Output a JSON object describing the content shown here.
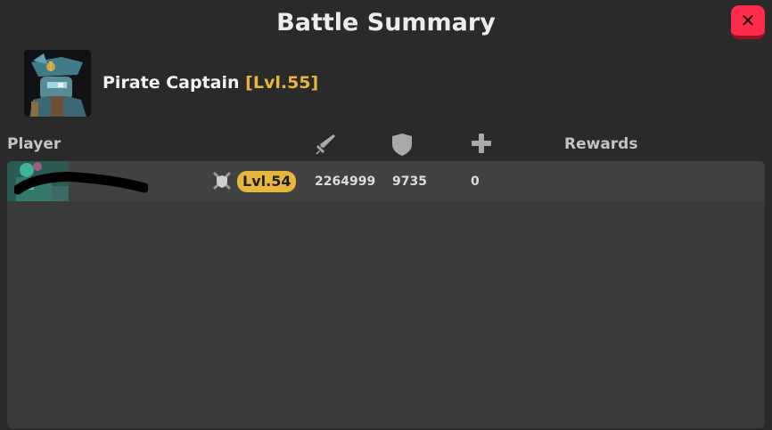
{
  "header": {
    "title": "Battle Summary",
    "close_label": "✕"
  },
  "boss": {
    "name": "Pirate Captain",
    "level_label": "[Lvl.55]",
    "portrait_icon": "pirate-captain-portrait"
  },
  "table": {
    "columns": {
      "player": "Player",
      "damage_icon": "sword-icon",
      "defense_icon": "shield-icon",
      "heal_icon": "plus-icon",
      "rewards": "Rewards"
    },
    "rows": [
      {
        "avatar_icon": "player-avatar",
        "name": "                      ",
        "rank_icon": "crossed-swords-shield-icon",
        "level": "Lvl.54",
        "damage": "2264999",
        "defense": "9735",
        "heal": "0"
      }
    ]
  },
  "colors": {
    "accent_gold": "#e7b73c",
    "close_red": "#ff2b4a",
    "background": "#2a2a2a"
  }
}
